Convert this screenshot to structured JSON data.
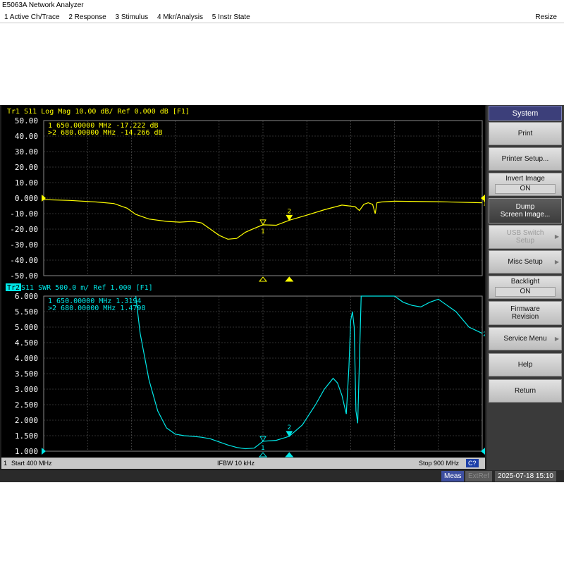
{
  "window": {
    "title": "E5063A Network Analyzer"
  },
  "menu": {
    "items": [
      "1 Active Ch/Trace",
      "2 Response",
      "3 Stimulus",
      "4 Mkr/Analysis",
      "5 Instr State"
    ],
    "resize_label": "Resize"
  },
  "colors": {
    "trace1": "#ffff00",
    "trace2": "#00e8e8",
    "grid": "#606060",
    "background": "#000000"
  },
  "trace1": {
    "header": "Tr1 S11 Log Mag 10.00 dB/ Ref 0.000 dB [F1]",
    "markers": [
      {
        "line": " 1   650.00000 MHz -17.222 dB",
        "num": "1"
      },
      {
        "line": ">2   680.00000 MHz -14.266 dB",
        "num": "2"
      }
    ],
    "ref_label": "1"
  },
  "trace2": {
    "header_badge": "Tr2",
    "header": " S11  SWR 500.0 m/ Ref 1.000  [F1]",
    "markers": [
      {
        "line": " 1   650.00000 MHz  1.3194",
        "num": "1"
      },
      {
        "line": ">2   680.00000 MHz  1.4798",
        "num": "2"
      }
    ],
    "ref_label": "2"
  },
  "chart_data": [
    {
      "type": "line",
      "title": "Tr1 S11 Log Mag 10.00 dB/ Ref 0.000 dB [F1]",
      "xlabel": "",
      "ylabel": "",
      "xlim": [
        400,
        900
      ],
      "ylim": [
        -50,
        50
      ],
      "yticks": [
        "50.00",
        "40.00",
        "30.00",
        "20.00",
        "10.00",
        "0.000",
        "-10.00",
        "-20.00",
        "-30.00",
        "-40.00",
        "-50.00"
      ],
      "grid": true,
      "x": [
        400,
        430,
        460,
        480,
        495,
        505,
        520,
        540,
        555,
        570,
        580,
        590,
        600,
        610,
        620,
        630,
        640,
        650,
        665,
        680,
        700,
        720,
        740,
        755,
        760,
        765,
        770,
        775,
        778,
        780,
        785,
        800,
        850,
        900
      ],
      "y": [
        -1.0,
        -1.5,
        -2.5,
        -3.5,
        -6.5,
        -10.5,
        -13.5,
        -15.0,
        -15.5,
        -15.0,
        -16.0,
        -20.0,
        -24.0,
        -26.5,
        -26.0,
        -22.0,
        -19.5,
        -17.222,
        -17.5,
        -14.266,
        -11.0,
        -7.5,
        -4.5,
        -5.5,
        -8.0,
        -4.0,
        -3.0,
        -4.0,
        -10.0,
        -3.0,
        -2.5,
        -2.0,
        -2.3,
        -3.0
      ],
      "markers": [
        {
          "id": "1",
          "x": 650,
          "y": -17.222
        },
        {
          "id": "2",
          "x": 680,
          "y": -14.266
        }
      ]
    },
    {
      "type": "line",
      "title": "Tr2 S11 SWR 500.0 m/ Ref 1.000 [F1]",
      "xlabel": "",
      "ylabel": "",
      "xlim": [
        400,
        900
      ],
      "ylim": [
        1.0,
        6.0
      ],
      "yticks": [
        "6.000",
        "5.500",
        "5.000",
        "4.500",
        "4.000",
        "3.500",
        "3.000",
        "2.500",
        "2.000",
        "1.500",
        "1.000"
      ],
      "grid": true,
      "x": [
        505,
        510,
        520,
        530,
        540,
        550,
        560,
        570,
        580,
        590,
        600,
        610,
        620,
        630,
        640,
        650,
        665,
        680,
        695,
        710,
        720,
        730,
        735,
        740,
        745,
        748,
        750,
        752,
        754,
        756,
        758,
        762,
        800,
        810,
        820,
        830,
        840,
        850,
        870,
        885,
        900
      ],
      "y": [
        6.0,
        4.8,
        3.3,
        2.3,
        1.75,
        1.55,
        1.5,
        1.48,
        1.45,
        1.4,
        1.3,
        1.2,
        1.12,
        1.08,
        1.1,
        1.3194,
        1.35,
        1.4798,
        1.85,
        2.5,
        3.0,
        3.35,
        3.2,
        2.8,
        2.2,
        3.7,
        5.2,
        5.5,
        5.0,
        2.3,
        1.9,
        6.0,
        6.0,
        5.8,
        5.7,
        5.65,
        5.8,
        5.9,
        5.5,
        5.0,
        4.8
      ],
      "markers": [
        {
          "id": "1",
          "x": 650,
          "y": 1.3194
        },
        {
          "id": "2",
          "x": 680,
          "y": 1.4798
        }
      ]
    }
  ],
  "softkeys": {
    "title": "System",
    "items": [
      {
        "label": "Print",
        "value": null
      },
      {
        "label": "Printer Setup...",
        "value": null
      },
      {
        "label": "Invert Image",
        "value": "ON"
      },
      {
        "label": "Dump",
        "label2": "Screen Image...",
        "value": null
      },
      {
        "label": "USB Switch",
        "label2": "Setup",
        "value": null
      },
      {
        "label": "Misc Setup",
        "value": null
      },
      {
        "label": "Backlight",
        "value": "ON"
      },
      {
        "label": "Firmware",
        "label2": "Revision",
        "value": null
      },
      {
        "label": "Service Menu",
        "value": null
      },
      {
        "label": "Help",
        "value": null
      },
      {
        "label": "Return",
        "value": null
      }
    ]
  },
  "status": {
    "channel": "1",
    "start": "Start 400 MHz",
    "ifbw": "IFBW 10 kHz",
    "stop": "Stop 900 MHz",
    "c2": "C?"
  },
  "bottom": {
    "meas": "Meas",
    "extref": "ExtRef",
    "datetime": "2025-07-18 15:10"
  }
}
